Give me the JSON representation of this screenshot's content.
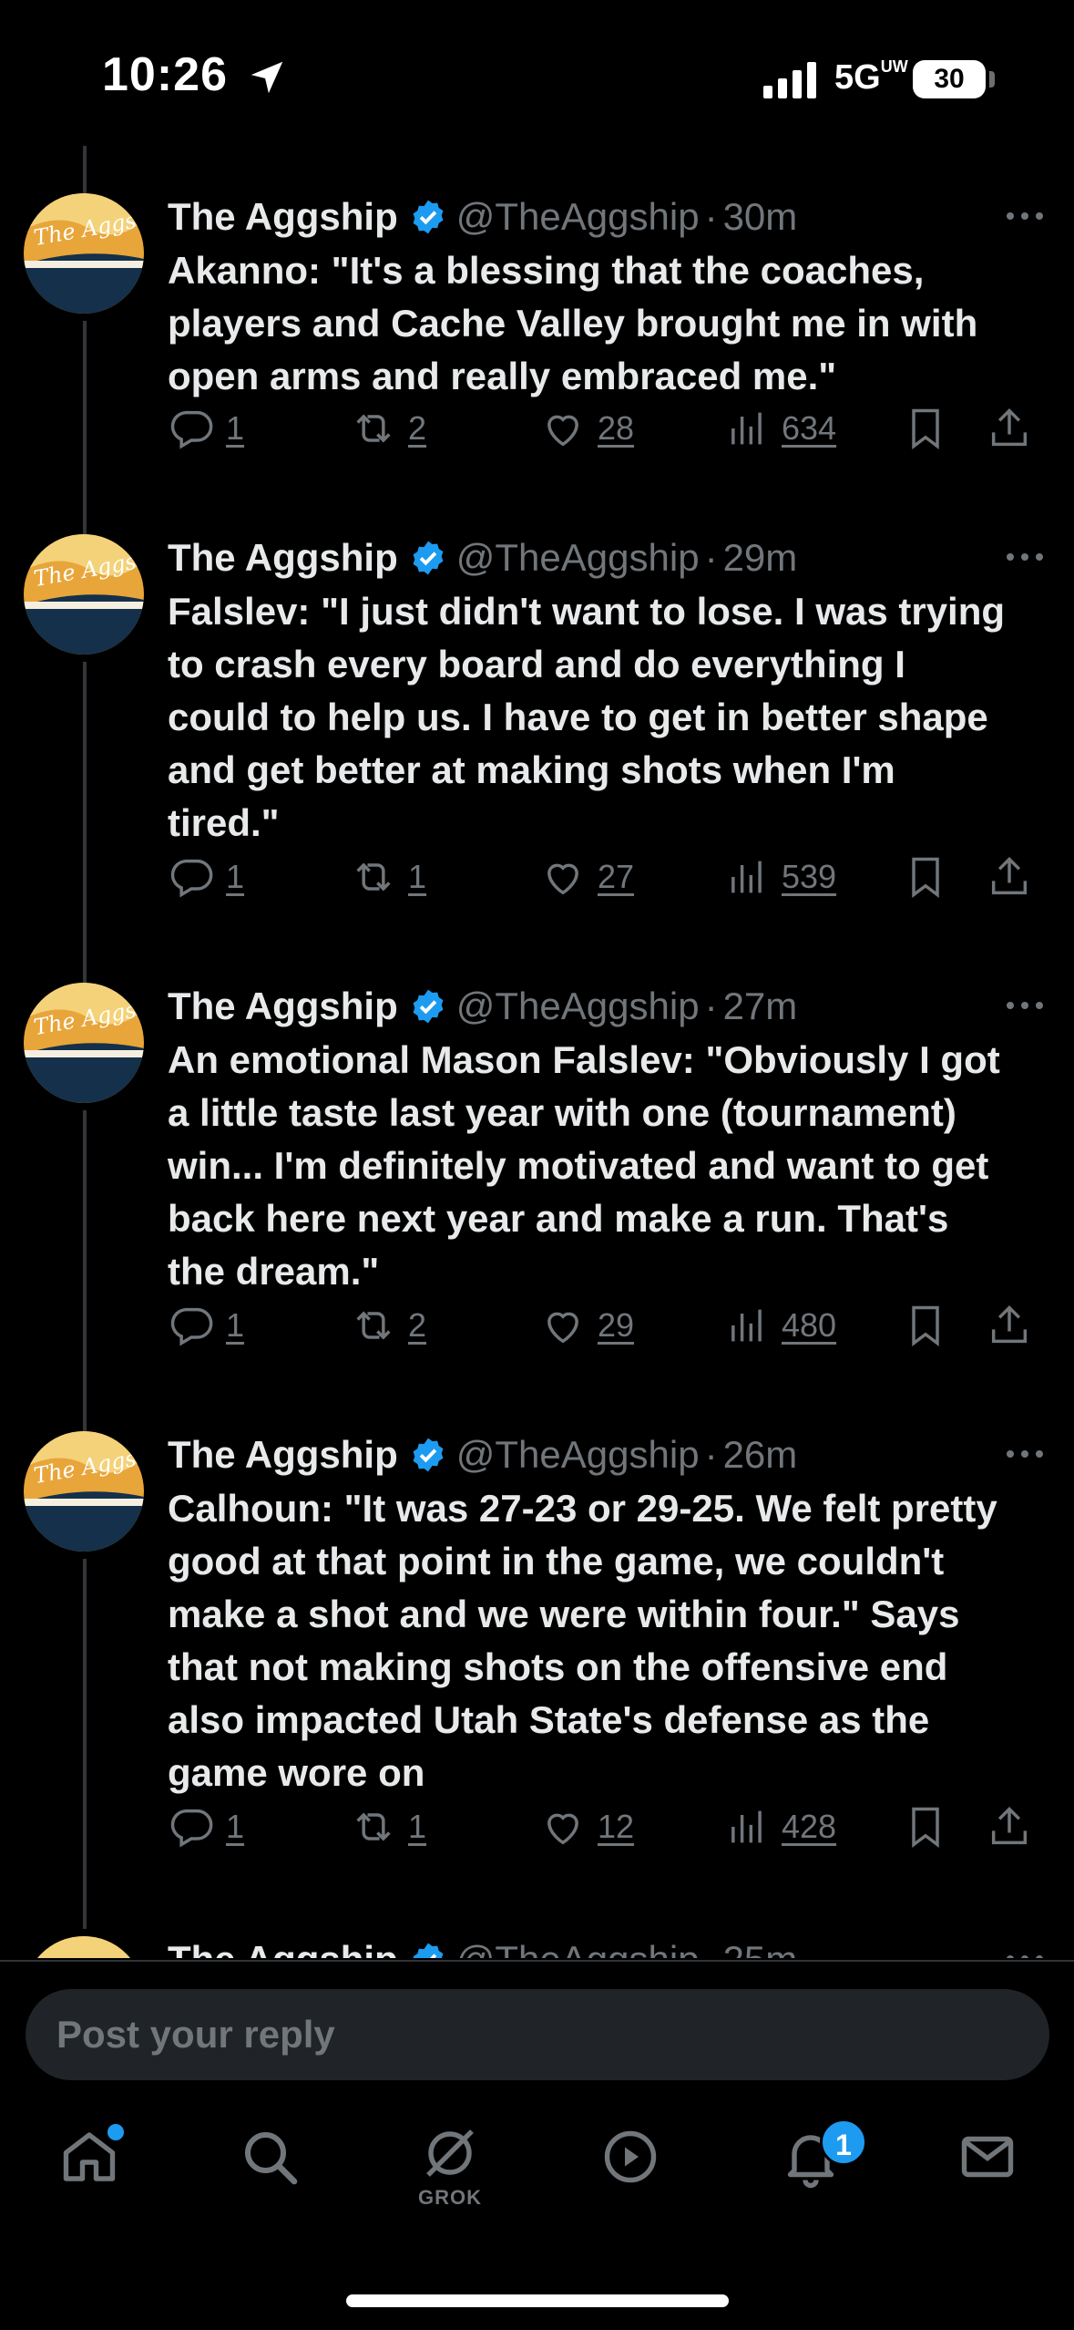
{
  "status_bar": {
    "time": "10:26",
    "network": "5G",
    "network_sup": "UW",
    "battery": "30"
  },
  "colors": {
    "accent": "#1d9bf0",
    "background": "#000000",
    "muted": "#71767b",
    "text": "#e7e9ea"
  },
  "avatar_text": "The Aggship",
  "tweets": [
    {
      "name": "The Aggship",
      "handle": "@TheAggship",
      "dot": "·",
      "time": "30m",
      "text": "Akanno: \"It's a blessing that the coaches, players and Cache Valley brought me in with open arms and really embraced me.\"",
      "replies": "1",
      "reposts": "2",
      "likes": "28",
      "views": "634"
    },
    {
      "name": "The Aggship",
      "handle": "@TheAggship",
      "dot": "·",
      "time": "29m",
      "text": "Falslev: \"I just didn't want to lose. I was trying to crash every board and do everything I could to help us. I have to get in better shape and get better at making shots when I'm tired.\"",
      "replies": "1",
      "reposts": "1",
      "likes": "27",
      "views": "539"
    },
    {
      "name": "The Aggship",
      "handle": "@TheAggship",
      "dot": "·",
      "time": "27m",
      "text": "An emotional Mason Falslev: \"Obviously I got a little taste last year with one (tournament) win... I'm definitely motivated and want to get back here next year and make a run. That's the dream.\"",
      "replies": "1",
      "reposts": "2",
      "likes": "29",
      "views": "480"
    },
    {
      "name": "The Aggship",
      "handle": "@TheAggship",
      "dot": "·",
      "time": "26m",
      "text": "Calhoun: \"It was 27-23 or 29-25. We felt pretty good at that point in the game, we couldn't make a shot and we were within four.\" Says that not making shots on the offensive end also impacted Utah State's defense as the game wore on",
      "replies": "1",
      "reposts": "1",
      "likes": "12",
      "views": "428"
    },
    {
      "name": "The Aggship",
      "handle": "@TheAggship",
      "dot": "·",
      "time": "25m",
      "text": "",
      "replies": "",
      "reposts": "",
      "likes": "",
      "views": ""
    }
  ],
  "reply_bar": {
    "placeholder": "Post your reply"
  },
  "tab_bar": {
    "grok_label": "GROK",
    "notification_count": "1"
  },
  "icons": {
    "status": [
      "location-arrow-icon",
      "signal-icon"
    ],
    "tweet": [
      "verified-badge-icon",
      "more-icon",
      "reply-icon",
      "repost-icon",
      "like-icon",
      "views-icon",
      "bookmark-icon",
      "share-icon"
    ],
    "tabs": [
      "home-icon",
      "search-icon",
      "grok-icon",
      "video-icon",
      "notifications-icon",
      "messages-icon"
    ]
  }
}
